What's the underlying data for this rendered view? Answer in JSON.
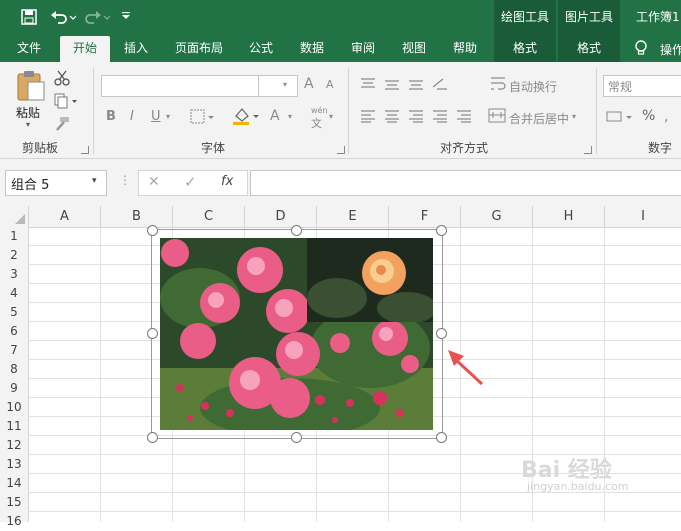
{
  "qat": {
    "save_icon": "save-icon",
    "undo_icon": "undo-icon",
    "redo_icon": "redo-icon",
    "customize_icon": "customize-qat-icon"
  },
  "context_tabs": {
    "drawing_tools": "绘图工具",
    "picture_tools": "图片工具",
    "workbook_title": "工作簿1"
  },
  "tabs": [
    "文件",
    "开始",
    "插入",
    "页面布局",
    "公式",
    "数据",
    "审阅",
    "视图",
    "帮助",
    "格式",
    "格式"
  ],
  "tell_me": {
    "icon": "lightbulb-icon",
    "label": "操作"
  },
  "ribbon": {
    "clipboard": {
      "paste_label": "粘贴",
      "group_label": "剪贴板"
    },
    "font": {
      "group_label": "字体",
      "bold": "B",
      "italic": "I",
      "underline": "U",
      "grow": "A",
      "shrink": "A",
      "font_color": "A",
      "wen": "wén",
      "wen_char": "文"
    },
    "alignment": {
      "group_label": "对齐方式",
      "wrap_text": "自动换行",
      "merge_center": "合并后居中"
    },
    "number": {
      "group_label": "数字",
      "format_value": "常规",
      "percent": "%"
    }
  },
  "formula_bar": {
    "name_box": "组合 5",
    "cancel": "✕",
    "enter": "✓",
    "fx": "fx",
    "formula": ""
  },
  "columns": [
    "A",
    "B",
    "C",
    "D",
    "E",
    "F",
    "G",
    "H",
    "I"
  ],
  "rows": [
    "1",
    "2",
    "3",
    "4",
    "5",
    "6",
    "7",
    "8",
    "9",
    "10",
    "11",
    "12",
    "13",
    "14",
    "15",
    "16"
  ],
  "selected_object": "组合 5",
  "accent_colors": {
    "excel_green": "#217346",
    "context_green": "#1a5c38",
    "arrow_red": "#e8524f"
  },
  "watermark": {
    "brand": "Bai 经验",
    "url": "jingyan.baidu.com"
  }
}
